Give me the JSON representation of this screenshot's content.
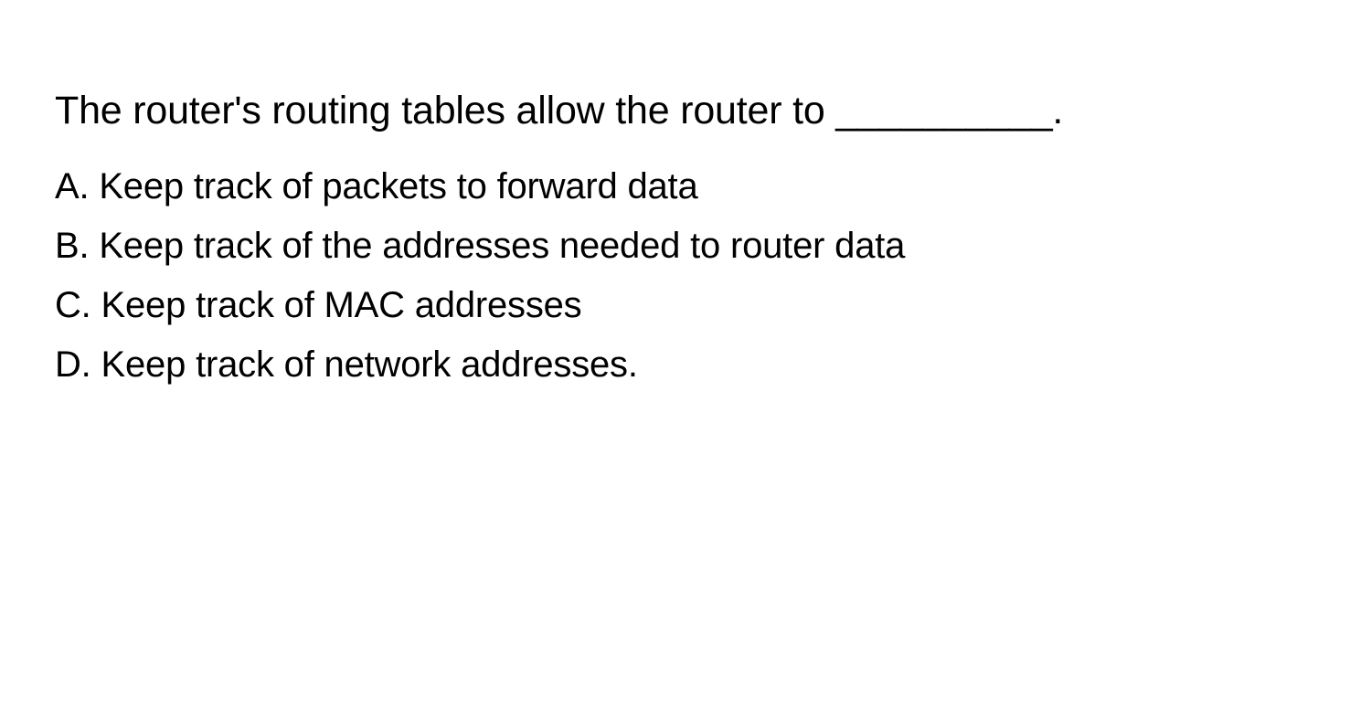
{
  "question": {
    "stem": "The router's routing tables allow the router to __________."
  },
  "options": [
    {
      "label": "A.",
      "text": "Keep track of packets to forward data"
    },
    {
      "label": "B.",
      "text": "Keep track of the addresses needed to router data"
    },
    {
      "label": "C.",
      "text": "Keep track of MAC addresses"
    },
    {
      "label": "D.",
      "text": "Keep track of network addresses."
    }
  ]
}
